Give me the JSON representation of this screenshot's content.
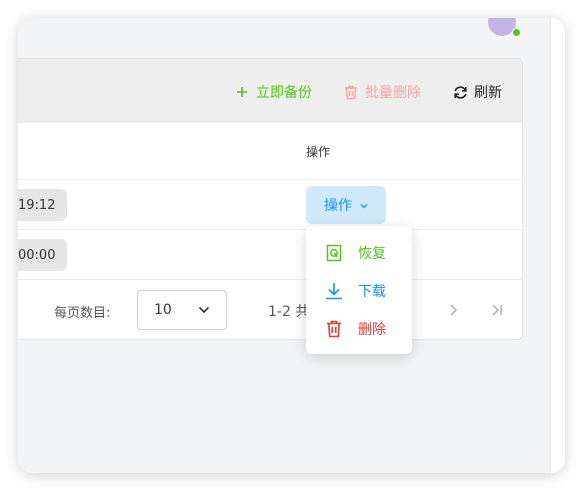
{
  "toolbar": {
    "backup_label": "立即备份",
    "batch_delete_label": "批量删除",
    "refresh_label": "刷新"
  },
  "table": {
    "headers": {
      "ops": "操作"
    },
    "rows": [
      {
        "time": "19:12",
        "ops_label": "操作"
      },
      {
        "time": "00:00"
      }
    ]
  },
  "pagination": {
    "per_page_label": "每页数目:",
    "per_page_value": "10",
    "range_text": "1-2 共"
  },
  "dropdown": {
    "items": [
      {
        "label": "恢复",
        "icon": "restore-icon",
        "color": "#52c41a"
      },
      {
        "label": "下载",
        "icon": "download-icon",
        "color": "#1890ff"
      },
      {
        "label": "删除",
        "icon": "trash-icon",
        "color": "#e53935"
      }
    ]
  },
  "colors": {
    "accent_green": "#52c41a",
    "accent_blue": "#1890ff",
    "danger_red": "#e53935",
    "disabled_red": "#f5a3a3"
  }
}
